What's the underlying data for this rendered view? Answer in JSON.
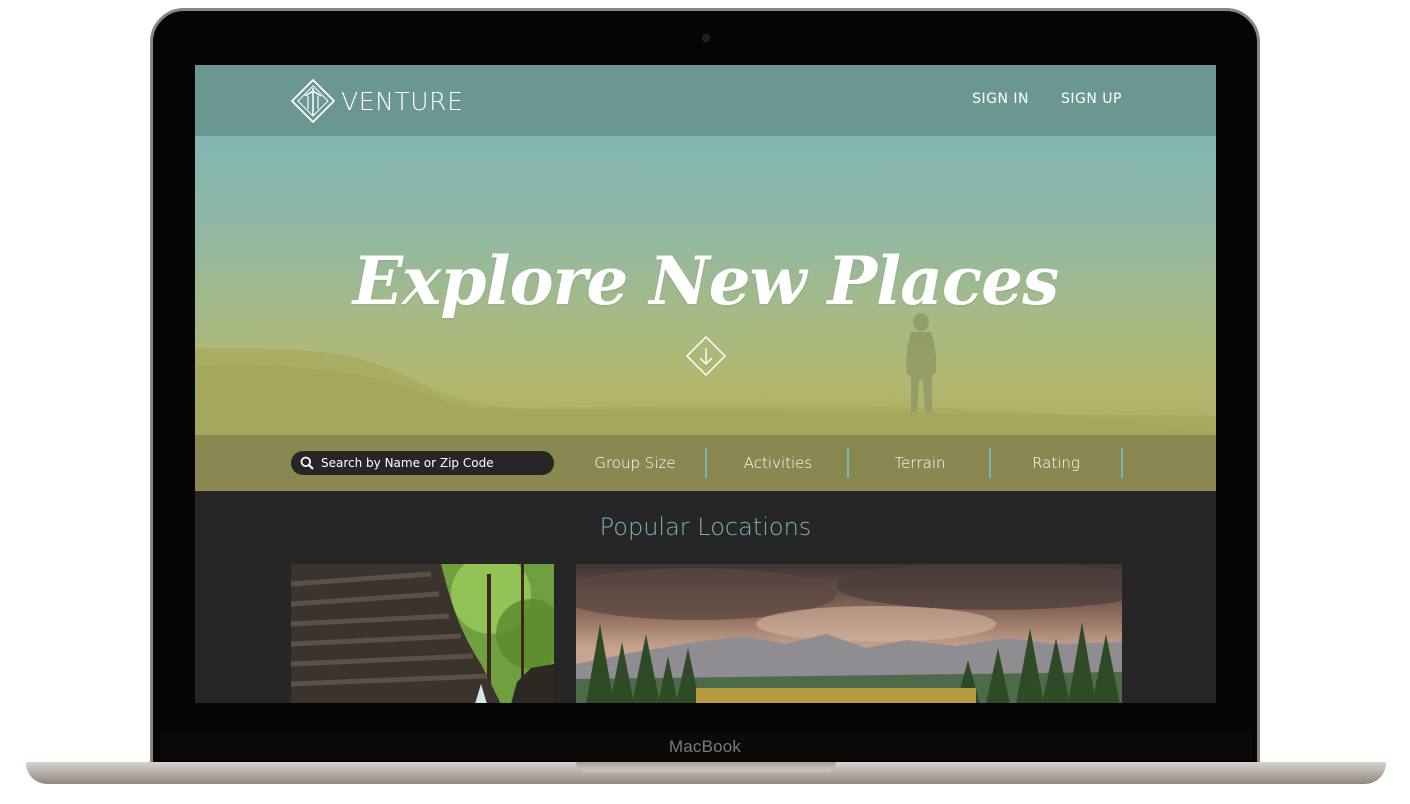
{
  "device": {
    "label": "MacBook"
  },
  "nav": {
    "brand": "VENTURE",
    "links": [
      {
        "label": "SIGN IN"
      },
      {
        "label": "SIGN UP"
      }
    ]
  },
  "hero": {
    "title": "Explore New Places"
  },
  "filters": {
    "search_placeholder": "Search by Name or Zip Code",
    "items": [
      {
        "label": "Group Size"
      },
      {
        "label": "Activities"
      },
      {
        "label": "Terrain"
      },
      {
        "label": "Rating"
      }
    ]
  },
  "popular": {
    "title": "Popular Locations"
  },
  "colors": {
    "nav": "#6b9692",
    "accent_teal": "#7fb3b1",
    "filter_bar": "#8a8850",
    "background_dark": "#262626"
  }
}
